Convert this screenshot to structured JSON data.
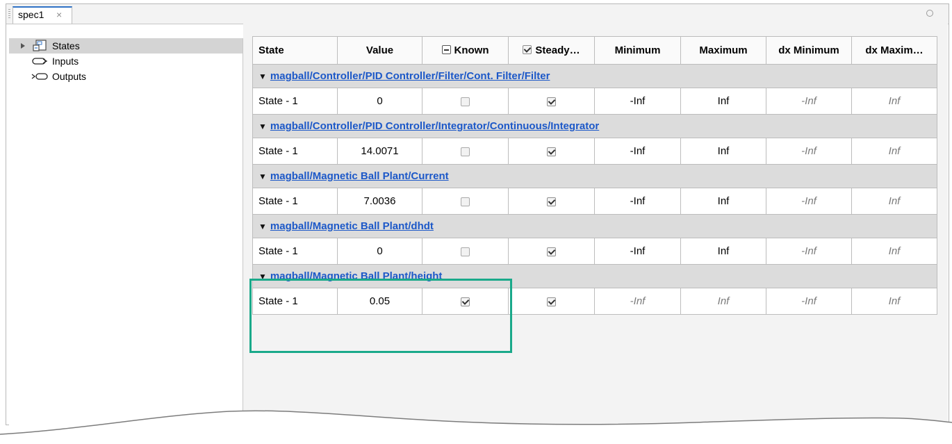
{
  "tab": {
    "title": "spec1",
    "close": "×"
  },
  "sidebar": {
    "items": [
      {
        "label": "States",
        "selected": true,
        "icon": "states-block-icon"
      },
      {
        "label": "Inputs",
        "selected": false,
        "icon": "input-port-icon"
      },
      {
        "label": "Outputs",
        "selected": false,
        "icon": "output-port-icon"
      }
    ]
  },
  "table": {
    "columns": [
      "State",
      "Value",
      "Known",
      "Steady…",
      "Minimum",
      "Maximum",
      "dx Minimum",
      "dx Maxim…"
    ],
    "groups": [
      {
        "path": "magball/Controller/PID Controller/Filter/Cont. Filter/Filter",
        "row": {
          "state": "State - 1",
          "value": "0",
          "known": false,
          "steady": true,
          "minimum": "-Inf",
          "maximum": "Inf",
          "dx_minimum": "-Inf",
          "dx_maximum": "Inf"
        }
      },
      {
        "path": "magball/Controller/PID Controller/Integrator/Continuous/Integrator",
        "row": {
          "state": "State - 1",
          "value": "14.0071",
          "known": false,
          "steady": true,
          "minimum": "-Inf",
          "maximum": "Inf",
          "dx_minimum": "-Inf",
          "dx_maximum": "Inf"
        }
      },
      {
        "path": "magball/Magnetic Ball Plant/Current",
        "row": {
          "state": "State - 1",
          "value": "7.0036",
          "known": false,
          "steady": true,
          "minimum": "-Inf",
          "maximum": "Inf",
          "dx_minimum": "-Inf",
          "dx_maximum": "Inf"
        }
      },
      {
        "path": "magball/Magnetic Ball Plant/dhdt",
        "row": {
          "state": "State - 1",
          "value": "0",
          "known": false,
          "steady": true,
          "minimum": "-Inf",
          "maximum": "Inf",
          "dx_minimum": "-Inf",
          "dx_maximum": "Inf"
        }
      },
      {
        "path": "magball/Magnetic Ball Plant/height",
        "row": {
          "state": "State - 1",
          "value": "0.05",
          "known": true,
          "steady": true,
          "minimum": "-Inf",
          "maximum": "Inf",
          "dx_minimum": "-Inf",
          "dx_maximum": "Inf"
        }
      }
    ]
  },
  "colors": {
    "link": "#1c58c8",
    "highlight": "#1aa98a",
    "group_bg": "#dcdcdc",
    "selected_bg": "#d4d4d4"
  }
}
